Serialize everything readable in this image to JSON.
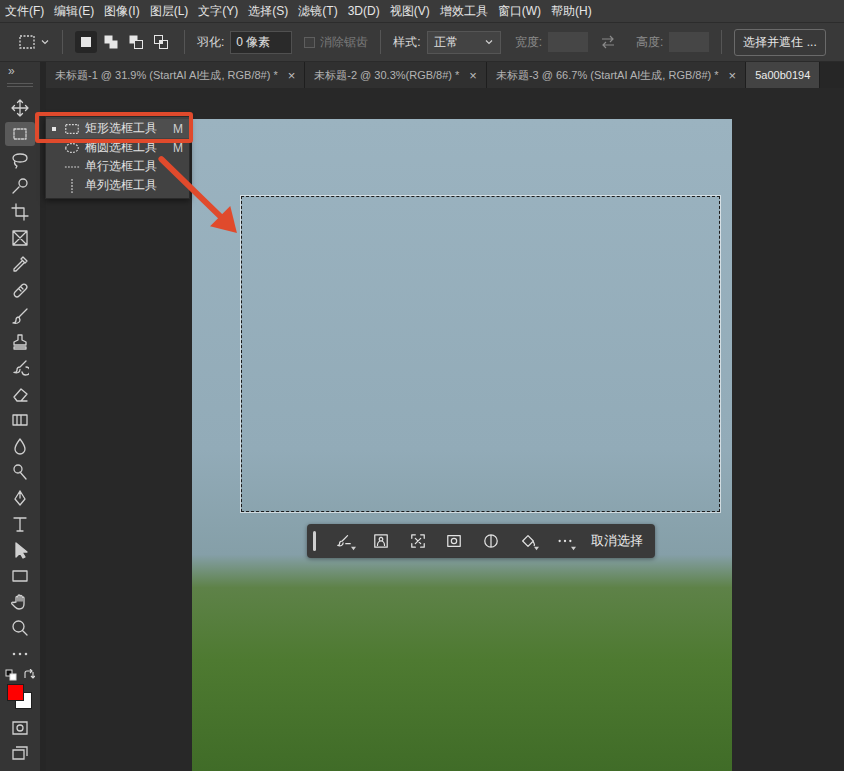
{
  "menu_bar": [
    "文件(F)",
    "编辑(E)",
    "图像(I)",
    "图层(L)",
    "文字(Y)",
    "选择(S)",
    "滤镜(T)",
    "3D(D)",
    "视图(V)",
    "增效工具",
    "窗口(W)",
    "帮助(H)"
  ],
  "options_bar": {
    "selection_modes": [
      {
        "selected": true
      },
      {
        "selected": false
      },
      {
        "selected": false
      },
      {
        "selected": false
      }
    ],
    "feather": {
      "label": "羽化:",
      "value": "0 像素"
    },
    "anti_alias": {
      "label": "消除锯齿",
      "checked": false,
      "disabled": true
    },
    "style": {
      "label": "样式:",
      "value": "正常"
    },
    "width": {
      "label": "宽度:",
      "value": "",
      "disabled": true
    },
    "height": {
      "label": "高度:",
      "value": "",
      "disabled": true
    },
    "select_and_mask": "选择并遮住 ..."
  },
  "toolbar": {
    "collapse": "»",
    "tools": [
      {
        "selected": false
      },
      {
        "selected": true
      },
      {
        "selected": false
      },
      {
        "selected": false
      },
      {
        "selected": false
      },
      {
        "selected": false
      },
      {
        "selected": false
      },
      {
        "selected": false
      },
      {
        "selected": false
      },
      {
        "selected": false
      },
      {
        "selected": false
      },
      {
        "selected": false
      },
      {
        "selected": false
      },
      {
        "selected": false
      },
      {
        "selected": false
      },
      {
        "selected": false
      },
      {
        "selected": false
      },
      {
        "selected": false
      },
      {
        "selected": false
      },
      {
        "selected": false
      },
      {
        "selected": false
      },
      {
        "selected": false
      }
    ],
    "foreground": "#ff0000",
    "background": "#ffffff"
  },
  "tabs": [
    {
      "label": "未标题-1 @ 31.9% (StartAI AI生成, RGB/8#) *",
      "close": "×",
      "selected": false
    },
    {
      "label": "未标题-2 @ 30.3%(RGB/8#) *",
      "close": "×",
      "selected": false
    },
    {
      "label": "未标题-3 @ 66.7% (StartAI AI生成, RGB/8#) *",
      "close": "×",
      "selected": false
    },
    {
      "label": "5a00b0194",
      "close": "",
      "selected": true
    }
  ],
  "tool_flyout": [
    {
      "label": "矩形选框工具",
      "shortcut": "M",
      "selected": true
    },
    {
      "label": "椭圆选框工具",
      "shortcut": "M",
      "selected": false
    },
    {
      "label": "单行选框工具",
      "shortcut": "",
      "selected": false
    },
    {
      "label": "单列选框工具",
      "shortcut": "",
      "selected": false
    }
  ],
  "canvas": {
    "selection_visible": true
  },
  "contextual_task_bar": {
    "tools": [
      {
        "dropdown": true
      },
      {
        "dropdown": false
      },
      {
        "dropdown": false
      },
      {
        "dropdown": false
      },
      {
        "dropdown": false
      },
      {
        "dropdown": true
      },
      {
        "dropdown": true
      }
    ],
    "deselect": "取消选择"
  }
}
